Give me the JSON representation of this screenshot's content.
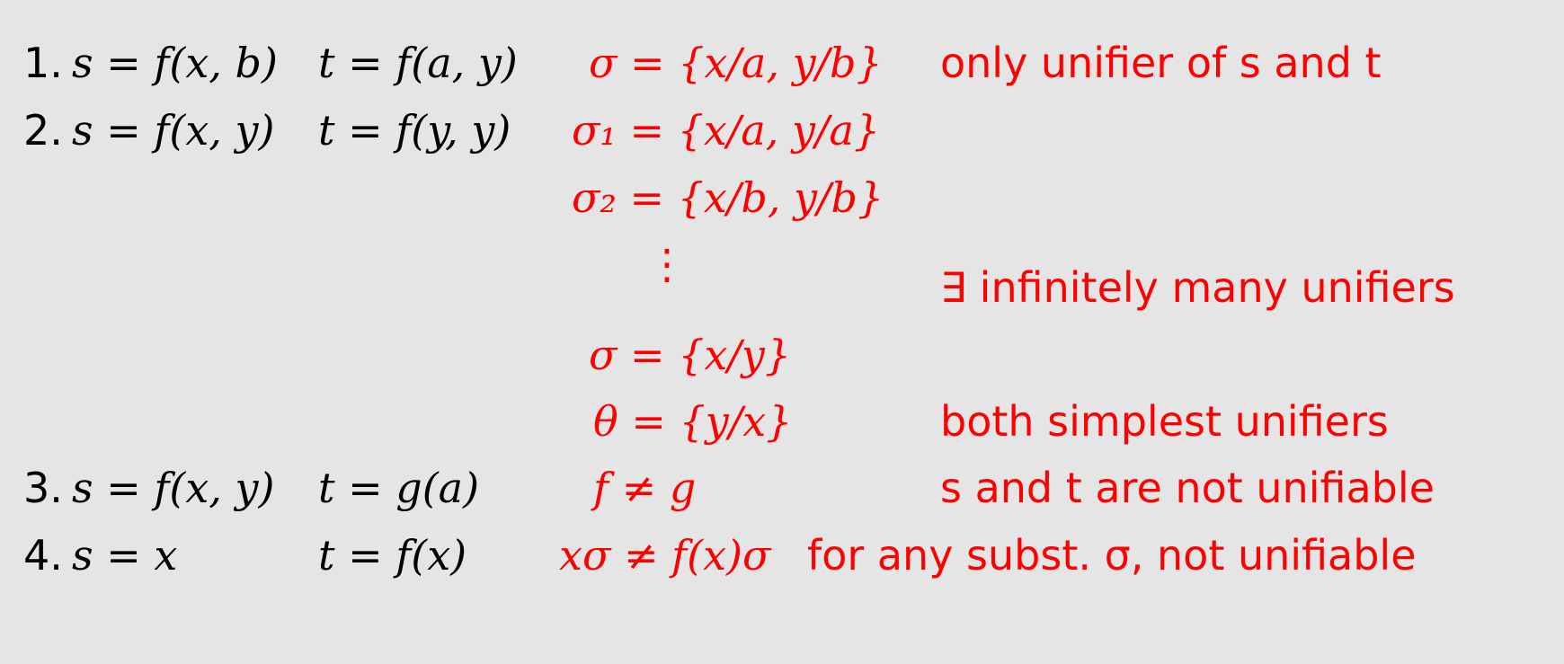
{
  "rows": [
    {
      "num": "1.",
      "s": "s = f(x, b)",
      "t": "t = f(a, y)",
      "sub": "σ = {x/a,  y/b}",
      "note": "only unifier of s and t"
    },
    {
      "num": "2.",
      "s": "s = f(x, y)",
      "t": "t = f(y, y)",
      "sub": "σ₁ = {x/a,  y/a}"
    },
    {
      "sub": "σ₂ = {x/b,  y/b}"
    },
    {
      "sub": "⋮",
      "note": "∃ infinitely many unifiers"
    },
    {
      "sub": "σ = {x/y}"
    },
    {
      "sub": "θ = {y/x}",
      "note": "both simplest unifiers"
    },
    {
      "num": "3.",
      "s": "s = f(x, y)",
      "t": "t = g(a)",
      "sub": "f ≠ g",
      "note": "s and t are not unifiable"
    },
    {
      "num": "4.",
      "s": "s = x",
      "t": "t = f(x)",
      "sub": "xσ ≠ f(x)σ",
      "note": "for any subst. σ,  not unifiable"
    }
  ]
}
